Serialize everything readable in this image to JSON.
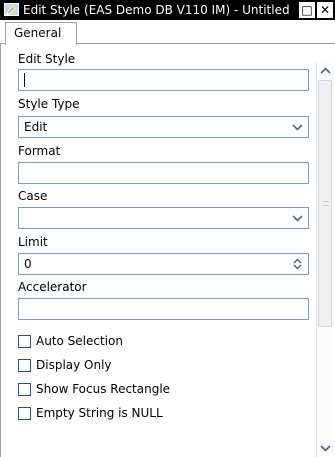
{
  "window": {
    "title": "Edit Style (EAS Demo DB V110 IM) - Untitled",
    "app_icon": "style-editor-icon",
    "buttons": {
      "maximize": "□",
      "close": "✕"
    }
  },
  "tabs": [
    {
      "label": "General",
      "selected": true
    }
  ],
  "form": {
    "edit_style": {
      "label": "Edit Style",
      "value": ""
    },
    "style_type": {
      "label": "Style Type",
      "value": "Edit"
    },
    "format": {
      "label": "Format",
      "value": ""
    },
    "case": {
      "label": "Case",
      "value": ""
    },
    "limit": {
      "label": "Limit",
      "value": "0"
    },
    "accelerator": {
      "label": "Accelerator",
      "value": ""
    },
    "checkboxes": [
      {
        "label": "Auto Selection",
        "checked": false
      },
      {
        "label": "Display Only",
        "checked": false
      },
      {
        "label": "Show Focus Rectangle",
        "checked": false
      },
      {
        "label": "Empty String is NULL",
        "checked": false
      }
    ]
  },
  "scrollbar": {
    "icons": [
      "chevron-up-icon",
      "chevron-down-icon"
    ]
  }
}
